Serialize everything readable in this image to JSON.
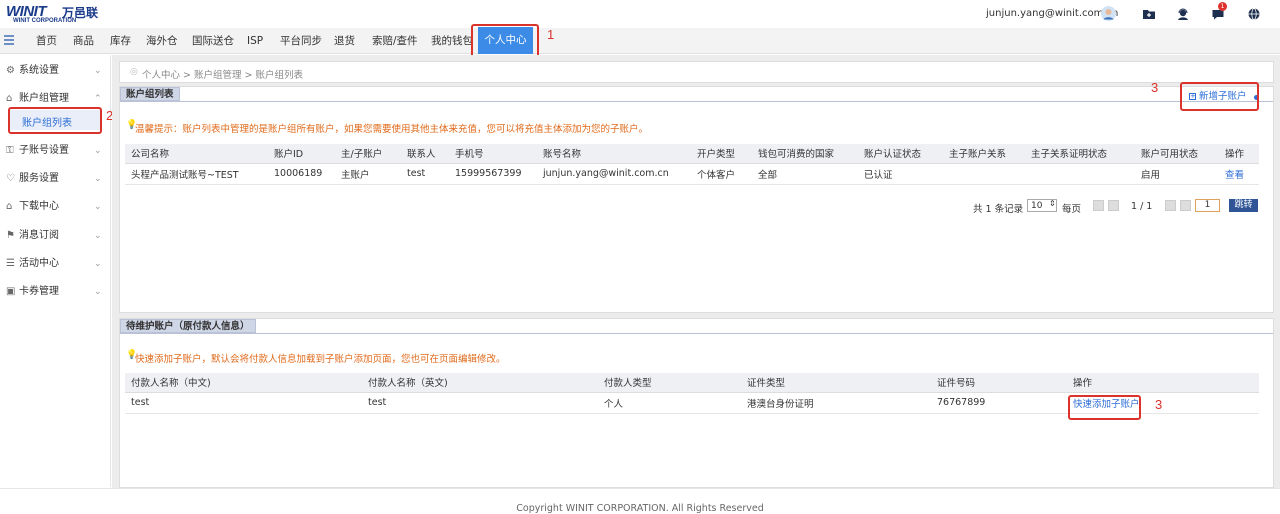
{
  "header": {
    "logo_text": "WINIT",
    "logo_cn": "万邑联",
    "logo_sub": "WINIT CORPORATION",
    "user_email": "junjun.yang@winit.com.cn",
    "notification_count": "1"
  },
  "nav": {
    "items": [
      "首页",
      "商品",
      "库存",
      "海外仓",
      "国际送仓",
      "ISP",
      "平台同步",
      "退货",
      "索赔/查件",
      "我的钱包",
      "个人中心"
    ],
    "active": "个人中心"
  },
  "annotations": {
    "n1": "1",
    "n2": "2",
    "n3a": "3",
    "n3b": "3"
  },
  "sidebar": {
    "items": [
      {
        "label": "系统设置",
        "icon": "settings-icon"
      },
      {
        "label": "账户组管理",
        "icon": "home-icon"
      },
      {
        "label": "子账号设置",
        "icon": "key-icon"
      },
      {
        "label": "服务设置",
        "icon": "heart-icon"
      },
      {
        "label": "下载中心",
        "icon": "home-icon"
      },
      {
        "label": "消息订阅",
        "icon": "bookmark-icon"
      },
      {
        "label": "活动中心",
        "icon": "list-icon"
      },
      {
        "label": "卡券管理",
        "icon": "ticket-icon"
      }
    ],
    "sub_item": "账户组列表"
  },
  "breadcrumb": "个人中心 > 账户组管理 > 账户组列表",
  "account_panel": {
    "title": "账户组列表",
    "add_button": "新增子账户",
    "tip": "温馨提示：账户列表中管理的是账户组所有账户，如果您需要使用其他主体来充值，您可以将充值主体添加为您的子账户。",
    "columns": [
      "公司名称",
      "账户ID",
      "主/子账户",
      "联系人",
      "手机号",
      "账号名称",
      "开户类型",
      "钱包可消费的国家",
      "账户认证状态",
      "主子账户关系",
      "主子关系证明状态",
      "账户可用状态",
      "操作"
    ],
    "rows": [
      [
        "头程产品测试账号~TEST",
        "10006189",
        "主账户",
        "test",
        "15999567399",
        "junjun.yang@winit.com.cn",
        "个体客户",
        "全部",
        "已认证",
        "",
        "",
        "启用",
        "查看"
      ]
    ],
    "pagination": {
      "total": "共 1 条记录",
      "page_size": "10",
      "per_page": "每页",
      "page": "1 / 1",
      "goto_value": "1",
      "jump": "跳转"
    }
  },
  "pending_panel": {
    "title": "待维护账户（原付款人信息）",
    "tip": "快速添加子账户，默认会将付款人信息加载到子账户添加页面，您也可在页面编辑修改。",
    "columns": [
      "付款人名称（中文)",
      "付款人名称（英文)",
      "付款人类型",
      "证件类型",
      "证件号码",
      "操作"
    ],
    "rows": [
      [
        "test",
        "test",
        "个人",
        "港澳台身份证明",
        "76767899",
        "快速添加子账户"
      ]
    ]
  },
  "footer": "Copyright WINIT CORPORATION. All Rights Reserved"
}
